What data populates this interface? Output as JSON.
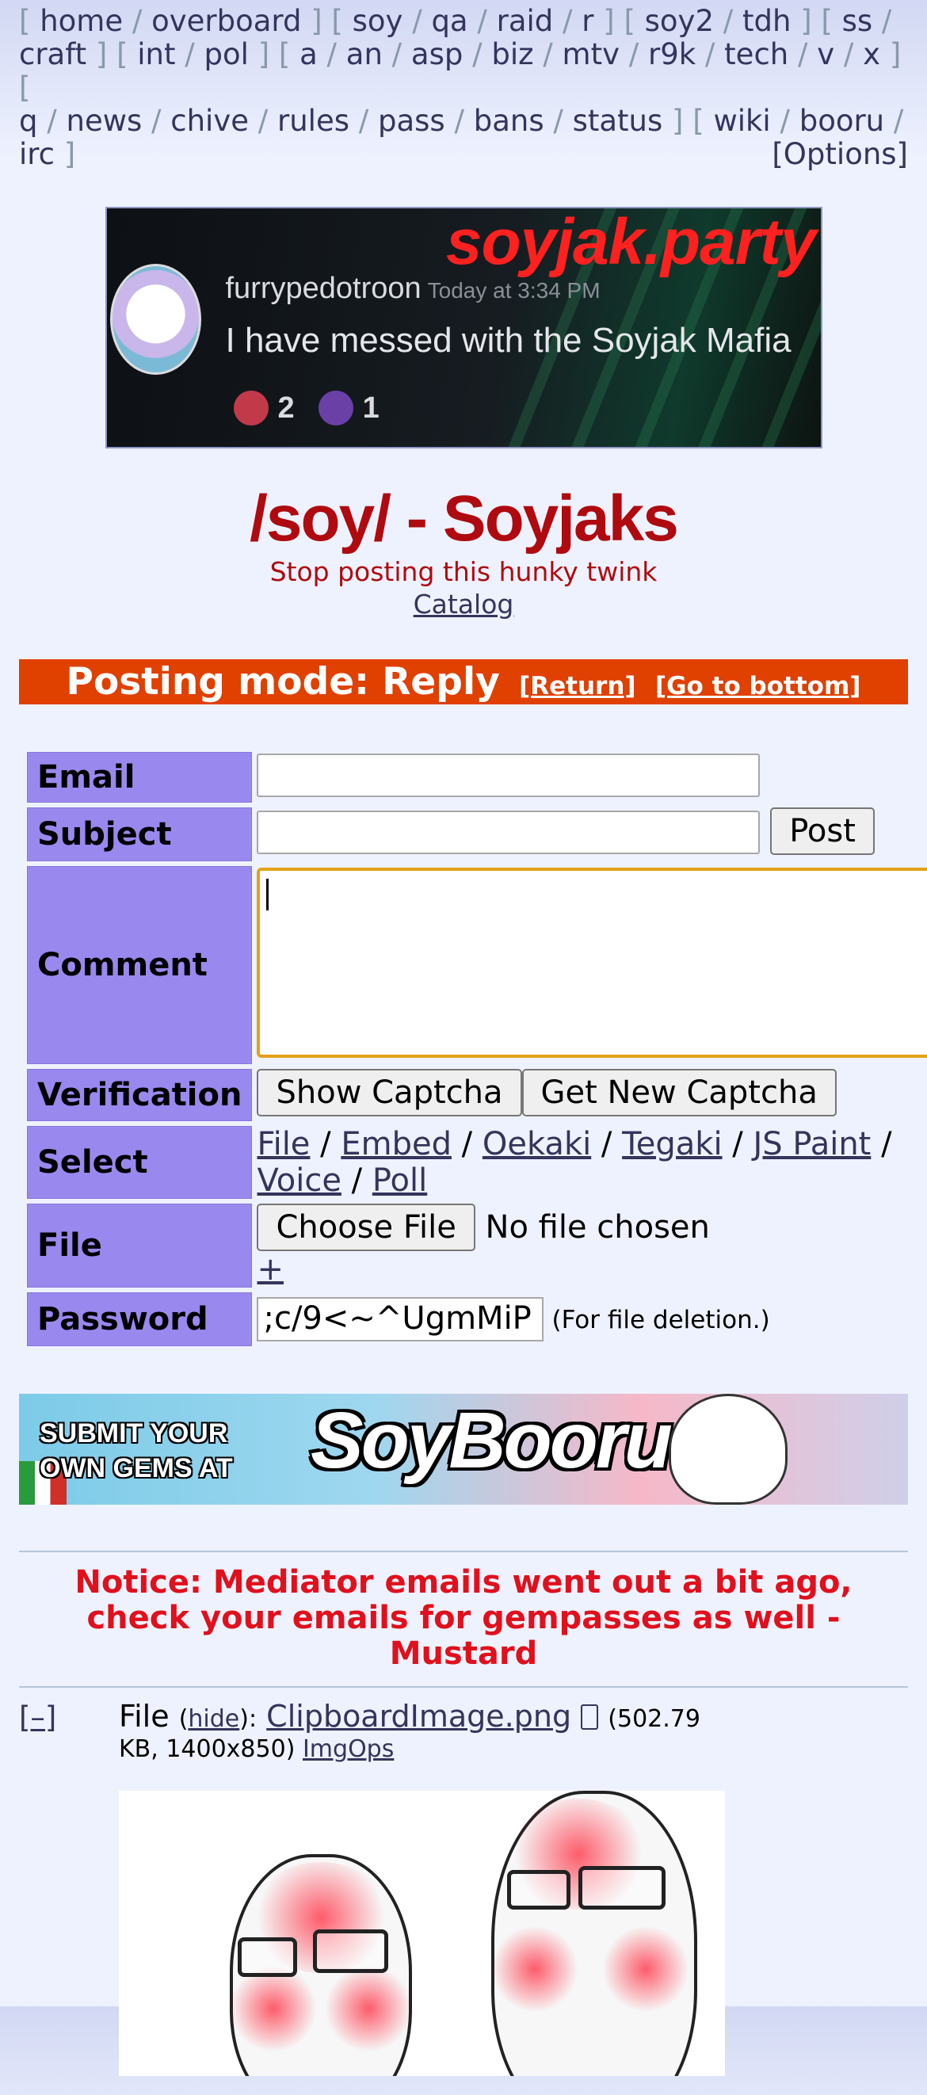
{
  "boardlist": {
    "row1": [
      "home",
      "overboard",
      "soy",
      "qa",
      "raid",
      "r",
      "soy2",
      "tdh",
      "ss"
    ],
    "row2": [
      "craft",
      "int",
      "pol",
      "a",
      "an",
      "asp",
      "biz",
      "mtv",
      "r9k",
      "tech",
      "v",
      "x"
    ],
    "row3": [
      "q",
      "news",
      "chive",
      "rules",
      "pass",
      "bans",
      "status",
      "wiki",
      "booru"
    ],
    "row4_item": "irc",
    "options": "[Options]"
  },
  "banner": {
    "brand": "soyjak.party",
    "username": "furrypedotroon",
    "time": "Today at 3:34 PM",
    "message": "I have messed with the Soyjak Mafia",
    "react1": "2",
    "react2": "1"
  },
  "header": {
    "title": "/soy/ - Soyjaks",
    "subtitle": "Stop posting this hunky twink",
    "catalog": "Catalog"
  },
  "mode": {
    "label": "Posting mode: Reply",
    "return": "[Return]",
    "bottom": "[Go to bottom]"
  },
  "form": {
    "email_label": "Email",
    "subject_label": "Subject",
    "post_button": "Post",
    "comment_label": "Comment",
    "verification_label": "Verification",
    "show_captcha": "Show Captcha",
    "new_captcha": "Get New Captcha",
    "select_label": "Select",
    "select_options": [
      "File",
      "Embed",
      "Oekaki",
      "Tegaki",
      "JS Paint",
      "Voice",
      "Poll"
    ],
    "file_label": "File",
    "choose_file": "Choose File",
    "no_file": "No file chosen",
    "plus": "+",
    "password_label": "Password",
    "password_value": ";c/9<~^UgmMiP",
    "password_hint": "(For file deletion.)"
  },
  "ad": {
    "line1": "SUBMIT YOUR",
    "line2": "OWN GEMS AT",
    "logo": "SoyBooru"
  },
  "notice": "Notice: Mediator emails went out a bit ago, check your emails for gempasses as well - Mustard",
  "post": {
    "toggle": "[–]",
    "file_word": "File",
    "hide": "hide",
    "filename": "ClipboardImage.png",
    "meta1": "(502.79",
    "meta2": "KB, 1400x850)",
    "imgops": "ImgOps"
  }
}
